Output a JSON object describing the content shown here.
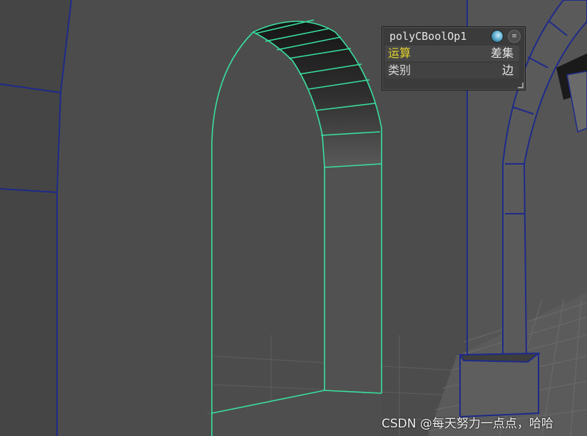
{
  "hud": {
    "title": "polyCBoolOp1",
    "globe_icon": "globe-icon",
    "menu_icon": "menu-icon",
    "menu_glyph": "≡",
    "rows": [
      {
        "label": "运算",
        "value": "差集"
      },
      {
        "label": "类别",
        "value": "边"
      }
    ]
  },
  "watermark": "CSDN @每天努力一点点，哈哈",
  "colors": {
    "selection_wire": "#39e0a0",
    "scene_wire": "#1e2a8a",
    "label_highlight": "#e6d62a",
    "background": "#4a4a4a"
  }
}
